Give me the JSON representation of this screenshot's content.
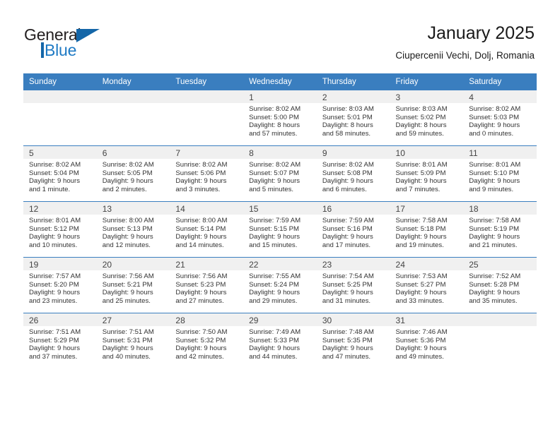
{
  "brand": {
    "name_top": "General",
    "name_bottom": "Blue",
    "triangle_color": "#1466a8",
    "blue_color": "#1f7ac4"
  },
  "header": {
    "title": "January 2025",
    "subtitle": "Ciupercenii Vechi, Dolj, Romania"
  },
  "theme": {
    "header_bg": "#3a7ebf",
    "daynum_band": "#f0f0f0",
    "row_divider": "#3a7ebf"
  },
  "calendar": {
    "weekday_headers": [
      "Sunday",
      "Monday",
      "Tuesday",
      "Wednesday",
      "Thursday",
      "Friday",
      "Saturday"
    ],
    "weeks": [
      [
        {
          "day": "",
          "sunrise": "",
          "sunset": "",
          "daylight1": "",
          "daylight2": ""
        },
        {
          "day": "",
          "sunrise": "",
          "sunset": "",
          "daylight1": "",
          "daylight2": ""
        },
        {
          "day": "",
          "sunrise": "",
          "sunset": "",
          "daylight1": "",
          "daylight2": ""
        },
        {
          "day": "1",
          "sunrise": "Sunrise: 8:02 AM",
          "sunset": "Sunset: 5:00 PM",
          "daylight1": "Daylight: 8 hours",
          "daylight2": "and 57 minutes."
        },
        {
          "day": "2",
          "sunrise": "Sunrise: 8:03 AM",
          "sunset": "Sunset: 5:01 PM",
          "daylight1": "Daylight: 8 hours",
          "daylight2": "and 58 minutes."
        },
        {
          "day": "3",
          "sunrise": "Sunrise: 8:03 AM",
          "sunset": "Sunset: 5:02 PM",
          "daylight1": "Daylight: 8 hours",
          "daylight2": "and 59 minutes."
        },
        {
          "day": "4",
          "sunrise": "Sunrise: 8:02 AM",
          "sunset": "Sunset: 5:03 PM",
          "daylight1": "Daylight: 9 hours",
          "daylight2": "and 0 minutes."
        }
      ],
      [
        {
          "day": "5",
          "sunrise": "Sunrise: 8:02 AM",
          "sunset": "Sunset: 5:04 PM",
          "daylight1": "Daylight: 9 hours",
          "daylight2": "and 1 minute."
        },
        {
          "day": "6",
          "sunrise": "Sunrise: 8:02 AM",
          "sunset": "Sunset: 5:05 PM",
          "daylight1": "Daylight: 9 hours",
          "daylight2": "and 2 minutes."
        },
        {
          "day": "7",
          "sunrise": "Sunrise: 8:02 AM",
          "sunset": "Sunset: 5:06 PM",
          "daylight1": "Daylight: 9 hours",
          "daylight2": "and 3 minutes."
        },
        {
          "day": "8",
          "sunrise": "Sunrise: 8:02 AM",
          "sunset": "Sunset: 5:07 PM",
          "daylight1": "Daylight: 9 hours",
          "daylight2": "and 5 minutes."
        },
        {
          "day": "9",
          "sunrise": "Sunrise: 8:02 AM",
          "sunset": "Sunset: 5:08 PM",
          "daylight1": "Daylight: 9 hours",
          "daylight2": "and 6 minutes."
        },
        {
          "day": "10",
          "sunrise": "Sunrise: 8:01 AM",
          "sunset": "Sunset: 5:09 PM",
          "daylight1": "Daylight: 9 hours",
          "daylight2": "and 7 minutes."
        },
        {
          "day": "11",
          "sunrise": "Sunrise: 8:01 AM",
          "sunset": "Sunset: 5:10 PM",
          "daylight1": "Daylight: 9 hours",
          "daylight2": "and 9 minutes."
        }
      ],
      [
        {
          "day": "12",
          "sunrise": "Sunrise: 8:01 AM",
          "sunset": "Sunset: 5:12 PM",
          "daylight1": "Daylight: 9 hours",
          "daylight2": "and 10 minutes."
        },
        {
          "day": "13",
          "sunrise": "Sunrise: 8:00 AM",
          "sunset": "Sunset: 5:13 PM",
          "daylight1": "Daylight: 9 hours",
          "daylight2": "and 12 minutes."
        },
        {
          "day": "14",
          "sunrise": "Sunrise: 8:00 AM",
          "sunset": "Sunset: 5:14 PM",
          "daylight1": "Daylight: 9 hours",
          "daylight2": "and 14 minutes."
        },
        {
          "day": "15",
          "sunrise": "Sunrise: 7:59 AM",
          "sunset": "Sunset: 5:15 PM",
          "daylight1": "Daylight: 9 hours",
          "daylight2": "and 15 minutes."
        },
        {
          "day": "16",
          "sunrise": "Sunrise: 7:59 AM",
          "sunset": "Sunset: 5:16 PM",
          "daylight1": "Daylight: 9 hours",
          "daylight2": "and 17 minutes."
        },
        {
          "day": "17",
          "sunrise": "Sunrise: 7:58 AM",
          "sunset": "Sunset: 5:18 PM",
          "daylight1": "Daylight: 9 hours",
          "daylight2": "and 19 minutes."
        },
        {
          "day": "18",
          "sunrise": "Sunrise: 7:58 AM",
          "sunset": "Sunset: 5:19 PM",
          "daylight1": "Daylight: 9 hours",
          "daylight2": "and 21 minutes."
        }
      ],
      [
        {
          "day": "19",
          "sunrise": "Sunrise: 7:57 AM",
          "sunset": "Sunset: 5:20 PM",
          "daylight1": "Daylight: 9 hours",
          "daylight2": "and 23 minutes."
        },
        {
          "day": "20",
          "sunrise": "Sunrise: 7:56 AM",
          "sunset": "Sunset: 5:21 PM",
          "daylight1": "Daylight: 9 hours",
          "daylight2": "and 25 minutes."
        },
        {
          "day": "21",
          "sunrise": "Sunrise: 7:56 AM",
          "sunset": "Sunset: 5:23 PM",
          "daylight1": "Daylight: 9 hours",
          "daylight2": "and 27 minutes."
        },
        {
          "day": "22",
          "sunrise": "Sunrise: 7:55 AM",
          "sunset": "Sunset: 5:24 PM",
          "daylight1": "Daylight: 9 hours",
          "daylight2": "and 29 minutes."
        },
        {
          "day": "23",
          "sunrise": "Sunrise: 7:54 AM",
          "sunset": "Sunset: 5:25 PM",
          "daylight1": "Daylight: 9 hours",
          "daylight2": "and 31 minutes."
        },
        {
          "day": "24",
          "sunrise": "Sunrise: 7:53 AM",
          "sunset": "Sunset: 5:27 PM",
          "daylight1": "Daylight: 9 hours",
          "daylight2": "and 33 minutes."
        },
        {
          "day": "25",
          "sunrise": "Sunrise: 7:52 AM",
          "sunset": "Sunset: 5:28 PM",
          "daylight1": "Daylight: 9 hours",
          "daylight2": "and 35 minutes."
        }
      ],
      [
        {
          "day": "26",
          "sunrise": "Sunrise: 7:51 AM",
          "sunset": "Sunset: 5:29 PM",
          "daylight1": "Daylight: 9 hours",
          "daylight2": "and 37 minutes."
        },
        {
          "day": "27",
          "sunrise": "Sunrise: 7:51 AM",
          "sunset": "Sunset: 5:31 PM",
          "daylight1": "Daylight: 9 hours",
          "daylight2": "and 40 minutes."
        },
        {
          "day": "28",
          "sunrise": "Sunrise: 7:50 AM",
          "sunset": "Sunset: 5:32 PM",
          "daylight1": "Daylight: 9 hours",
          "daylight2": "and 42 minutes."
        },
        {
          "day": "29",
          "sunrise": "Sunrise: 7:49 AM",
          "sunset": "Sunset: 5:33 PM",
          "daylight1": "Daylight: 9 hours",
          "daylight2": "and 44 minutes."
        },
        {
          "day": "30",
          "sunrise": "Sunrise: 7:48 AM",
          "sunset": "Sunset: 5:35 PM",
          "daylight1": "Daylight: 9 hours",
          "daylight2": "and 47 minutes."
        },
        {
          "day": "31",
          "sunrise": "Sunrise: 7:46 AM",
          "sunset": "Sunset: 5:36 PM",
          "daylight1": "Daylight: 9 hours",
          "daylight2": "and 49 minutes."
        },
        {
          "day": "",
          "sunrise": "",
          "sunset": "",
          "daylight1": "",
          "daylight2": ""
        }
      ]
    ]
  }
}
